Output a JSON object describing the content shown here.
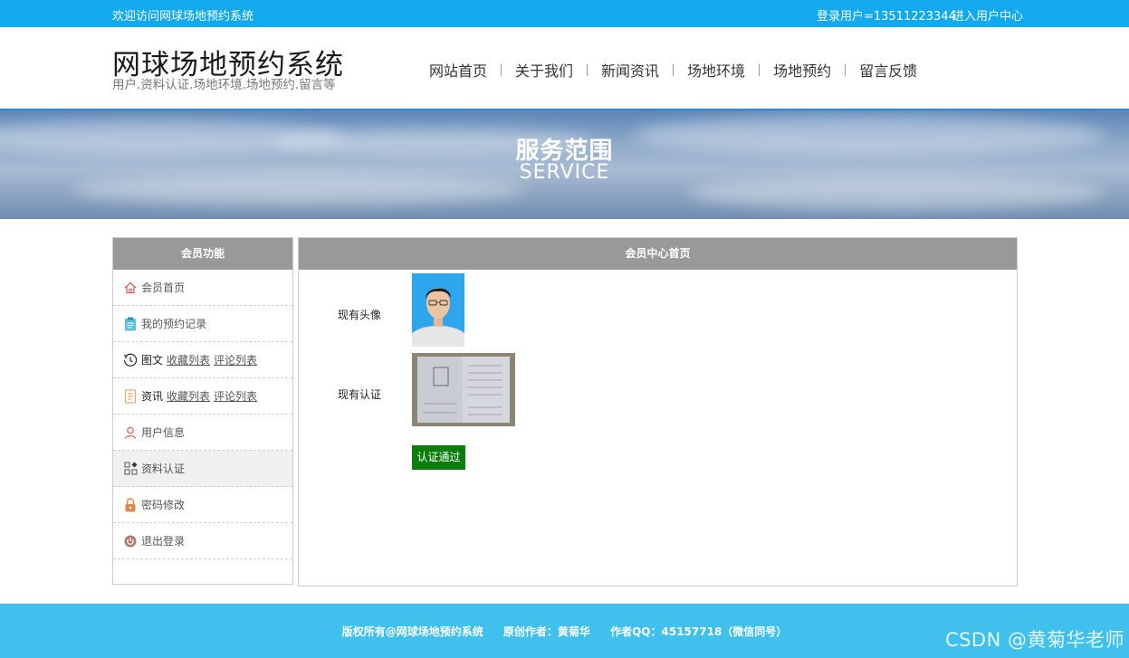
{
  "topbar": {
    "welcome": "欢迎访问网球场地预约系统",
    "user": "登录用户=13511223344",
    "center_link": "进入用户中心"
  },
  "header": {
    "title": "网球场地预约系统",
    "subtitle": "用户.资料认证.场地环境.场地预约.留言等"
  },
  "nav": [
    {
      "label": "网站首页"
    },
    {
      "label": "关于我们"
    },
    {
      "label": "新闻资讯"
    },
    {
      "label": "场地环境"
    },
    {
      "label": "场地预约"
    },
    {
      "label": "留言反馈"
    }
  ],
  "banner": {
    "title_cn": "服务范围",
    "title_en": "SERVICE"
  },
  "sidebar": {
    "title": "会员功能",
    "items": [
      {
        "label": "会员首页",
        "icon": "home-icon"
      },
      {
        "label": "我的预约记录",
        "icon": "clipboard-icon"
      },
      {
        "label": "图文",
        "sub1": "收藏列表",
        "sub2": "评论列表",
        "icon": "history-icon"
      },
      {
        "label": "资讯",
        "sub1": "收藏列表",
        "sub2": "评论列表",
        "icon": "document-icon"
      },
      {
        "label": "用户信息",
        "icon": "user-icon"
      },
      {
        "label": "资料认证",
        "icon": "grid-icon"
      },
      {
        "label": "密码修改",
        "icon": "lock-icon"
      },
      {
        "label": "退出登录",
        "icon": "power-icon"
      }
    ]
  },
  "content": {
    "title": "会员中心首页",
    "avatar_label": "现有头像",
    "cert_label": "现有认证",
    "status_button": "认证通过"
  },
  "footer": {
    "copyright": "版权所有@网球场地预约系统",
    "author": "原创作者：黄菊华",
    "qq": "作者QQ：45157718（微信同号）"
  },
  "watermark": "CSDN @黄菊华老师",
  "colors": {
    "topbar": "#12a9ee",
    "footer": "#40c0ec",
    "panel_header": "#999999",
    "status_green": "#0a7d0a"
  }
}
